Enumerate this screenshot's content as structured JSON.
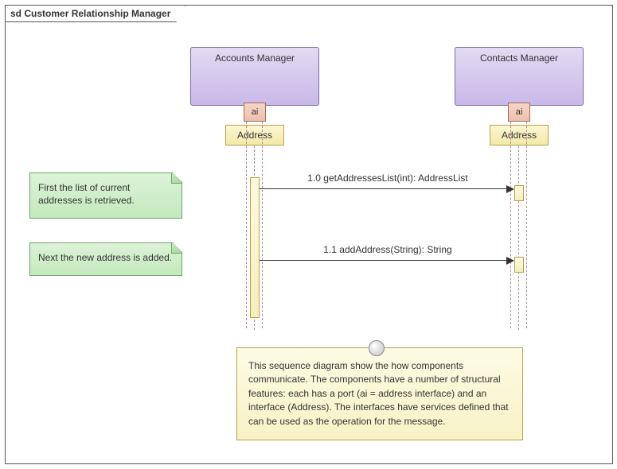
{
  "frame": {
    "prefix": "sd",
    "title": "Customer Relationship Manager"
  },
  "participants": {
    "accounts": {
      "name": "Accounts Manager",
      "port": "ai",
      "interface": "Address"
    },
    "contacts": {
      "name": "Contacts Manager",
      "port": "ai",
      "interface": "Address"
    }
  },
  "notes": {
    "n1": "First the list of current addresses is retrieved.",
    "n2": "Next the new address is added.",
    "bottom": "This sequence diagram show the how components communicate. The components have a number of structural features: each has a port (ai = address interface) and an interface (Address). The interfaces have services defined that can be used as the operation for the message."
  },
  "messages": {
    "m1": "1.0 getAddressesList(int): AddressList",
    "m2": "1.1 addAddress(String): String"
  }
}
